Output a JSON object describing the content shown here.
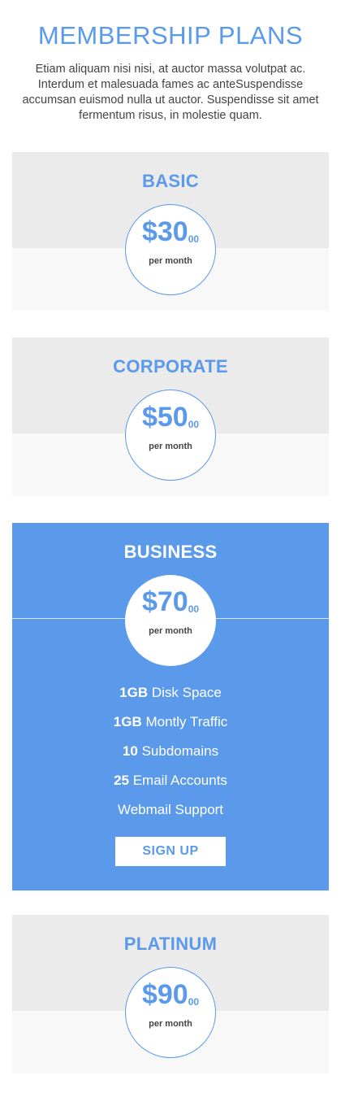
{
  "header": {
    "title": "MEMBERSHIP PLANS",
    "intro": "Etiam aliquam nisi nisi, at auctor massa volutpat ac. Interdum et malesuada fames ac anteSuspendisse accumsan euismod nulla ut auctor. Suspendisse sit amet fermentum risus, in molestie quam."
  },
  "plans": [
    {
      "name": "BASIC",
      "amount": "$30",
      "cents": "00",
      "period": "per month"
    },
    {
      "name": "CORPORATE",
      "amount": "$50",
      "cents": "00",
      "period": "per month"
    },
    {
      "name": "BUSINESS",
      "amount": "$70",
      "cents": "00",
      "period": "per month",
      "features": [
        {
          "bold": "1GB",
          "text": " Disk Space"
        },
        {
          "bold": "1GB",
          "text": " Montly Traffic"
        },
        {
          "bold": "10",
          "text": " Subdomains"
        },
        {
          "bold": "25",
          "text": " Email Accounts"
        },
        {
          "bold": "",
          "text": "Webmail Support"
        }
      ],
      "cta": "SIGN UP"
    },
    {
      "name": "PLATINUM",
      "amount": "$90",
      "cents": "00",
      "period": "per month"
    }
  ],
  "colors": {
    "accent": "#5b9aea",
    "panel_top": "#ebebeb",
    "panel_bottom": "#f8f8f8"
  }
}
